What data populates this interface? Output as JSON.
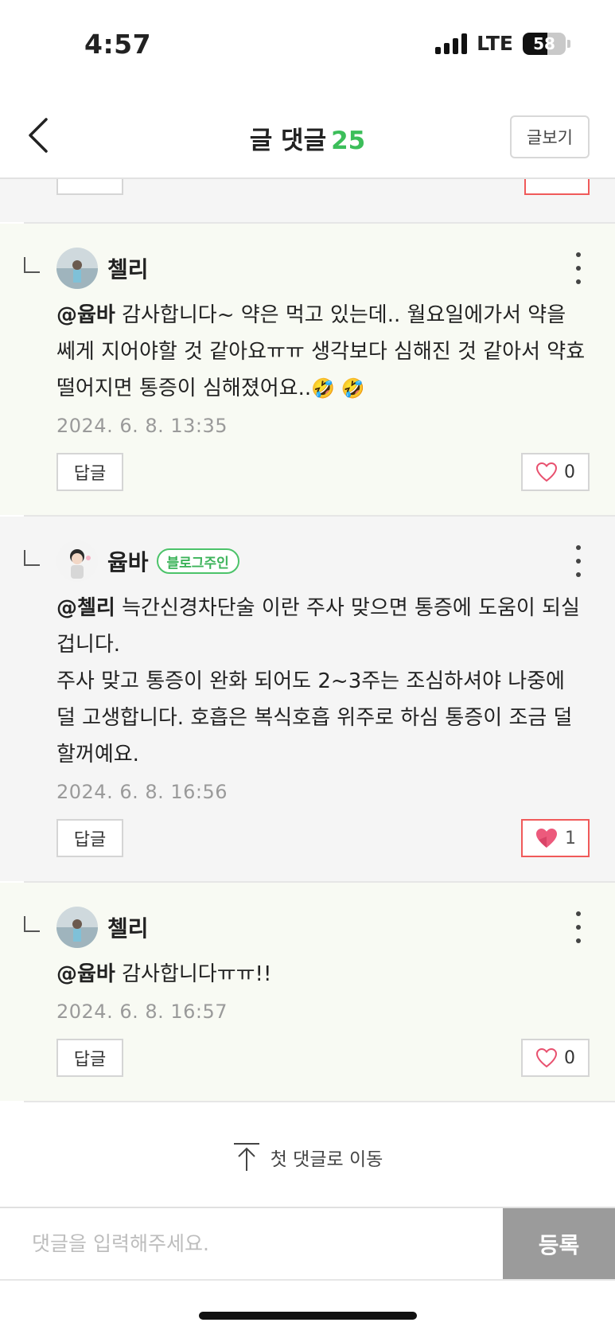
{
  "status_bar": {
    "time": "4:57",
    "network": "LTE",
    "battery": "58",
    "battery_level": 0.58
  },
  "header": {
    "title": "글 댓글",
    "count": "25",
    "view_post": "글보기"
  },
  "comments": [
    {
      "author": "첼리",
      "mention": "@윱바",
      "text": " 감사합니다~ 약은 먹고 있는데.. 월요일에가서 약을 쎄게 지어야할 것 같아요ㅠㅠ 생각보다 심해진 것 같아서 약효 떨어지면 통증이 심해졌어요..",
      "emoji": "🤣 🤣",
      "date": "2024. 6. 8. 13:35",
      "reply_label": "답글",
      "likes": "0"
    },
    {
      "author": "윱바",
      "badge": "블로그주인",
      "mention": "@첼리",
      "text_line1": " 늑간신경차단술 이란 주사 맞으면 통증에 도움이 되실 겁니다.",
      "text_line2": "주사 맞고 통증이 완화 되어도 2~3주는 조심하셔야 나중에 덜 고생합니다. 호흡은 복식호흡  위주로 하심 통증이 조금 덜 할꺼예요.",
      "date": "2024. 6. 8. 16:56",
      "reply_label": "답글",
      "likes": "1"
    },
    {
      "author": "첼리",
      "mention": "@윱바",
      "text": " 감사합니다ㅠㅠ!!",
      "date": "2024. 6. 8. 16:57",
      "reply_label": "답글",
      "likes": "0"
    }
  ],
  "jump_to_first": "첫 댓글로 이동",
  "input": {
    "placeholder": "댓글을 입력해주세요.",
    "value": ""
  },
  "submit_label": "등록",
  "colors": {
    "accent_green": "#3cbe5a",
    "like_red": "#f05a5a",
    "submit_gray": "#9b9b9b"
  },
  "icons": [
    "back-icon",
    "more-icon",
    "heart-outline-icon",
    "heart-filled-icon",
    "arrow-up-icon",
    "reply-indent-icon",
    "signal-icon",
    "battery-icon"
  ]
}
